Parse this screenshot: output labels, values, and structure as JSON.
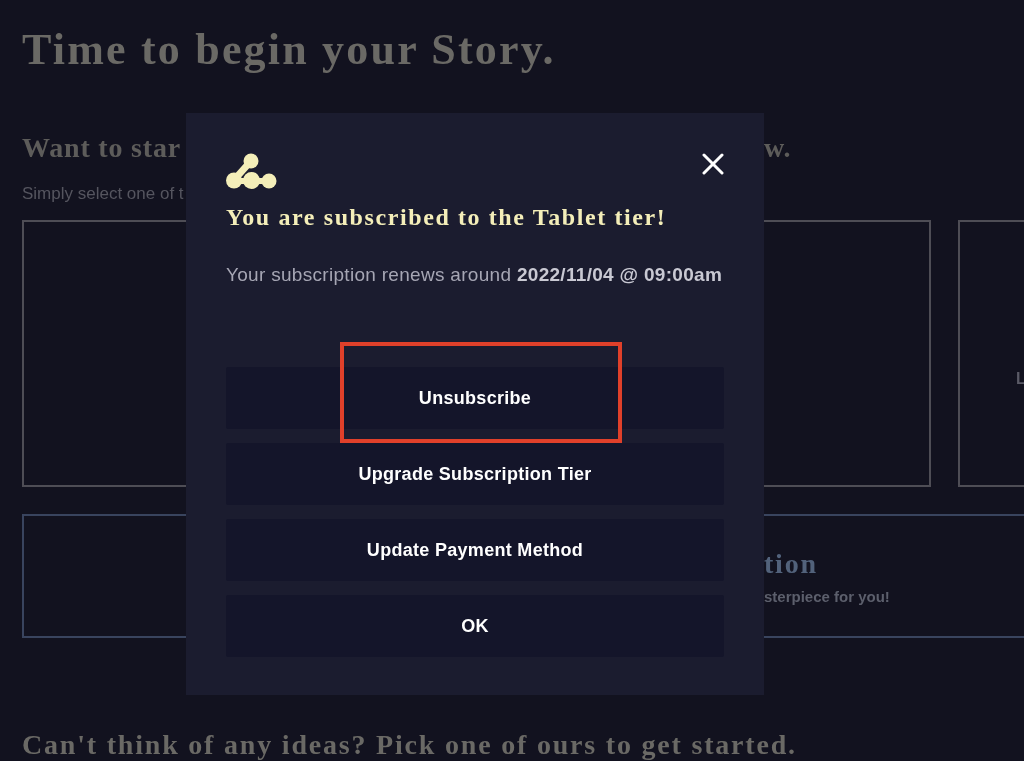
{
  "page": {
    "title": "Time to begin your Story.",
    "section": {
      "heading_parts": [
        "Want to star",
        "w."
      ],
      "hint": "Simply select one of t",
      "cards": [
        {
          "kind": "blank"
        },
        {
          "kind": "blank"
        },
        {
          "kind": "labeled",
          "label": "L"
        }
      ]
    },
    "feature_card": {
      "title": "tion",
      "description": "sterpiece for you!"
    },
    "ideas_heading": "Can't think of any ideas? Pick one of ours to get started."
  },
  "modal": {
    "title": "You are subscribed to the Tablet tier!",
    "renewal": "Your subscription renews around **2022/11/04 @ 09:00am**",
    "buttons": [
      {
        "label": "Unsubscribe",
        "highlighted": true
      },
      {
        "label": "Upgrade Subscription Tier",
        "highlighted": false
      },
      {
        "label": "Update Payment Method",
        "highlighted": false
      },
      {
        "label": "OK",
        "highlighted": false
      }
    ]
  }
}
